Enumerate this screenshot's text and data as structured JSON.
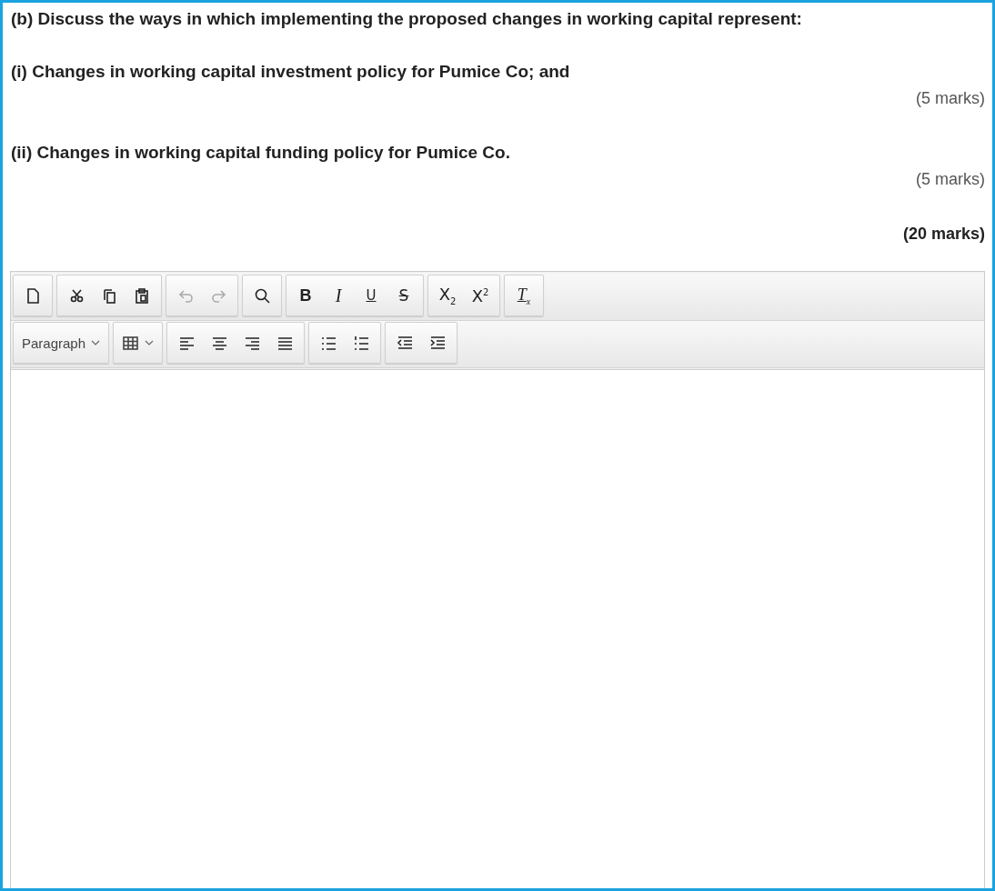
{
  "question": [
    {
      "kind": "text",
      "text": "(b) Discuss the ways in which implementing the proposed changes in working capital represent:"
    },
    {
      "kind": "text",
      "text": "(i) Changes in working capital investment policy for Pumice Co; and"
    },
    {
      "kind": "marks",
      "text": "(5 marks)"
    },
    {
      "kind": "text",
      "text": "(ii) Changes in working capital funding policy for Pumice Co."
    },
    {
      "kind": "marks",
      "text": "(5 marks)"
    },
    {
      "kind": "total",
      "text": "(20 marks)"
    }
  ],
  "editor": {
    "toolbar_rows": [
      [
        [
          {
            "kind": "icon",
            "disabled": false
          }
        ],
        [
          {
            "kind": "icon",
            "disabled": false
          },
          {
            "kind": "icon",
            "disabled": false
          },
          {
            "kind": "icon",
            "disabled": false
          }
        ],
        [
          {
            "kind": "icon",
            "disabled": true
          },
          {
            "kind": "icon",
            "disabled": true
          }
        ],
        [
          {
            "kind": "icon",
            "disabled": false
          }
        ],
        [
          {
            "kind": "text",
            "label": "B"
          },
          {
            "kind": "text",
            "label": "I"
          },
          {
            "kind": "text",
            "label": "U"
          },
          {
            "kind": "text",
            "label": "S"
          }
        ],
        [
          {
            "kind": "text",
            "label": "X$_{2}$"
          },
          {
            "kind": "text",
            "label": "X$^{2}$"
          }
        ],
        [
          {
            "kind": "text",
            "label": "T$_{x}$"
          }
        ]
      ],
      [
        [
          {
            "kind": "select",
            "label": "Paragraph"
          }
        ],
        [
          {
            "kind": "icon-select"
          }
        ],
        [
          {
            "kind": "icon",
            "disabled": false
          },
          {
            "kind": "icon",
            "disabled": false
          },
          {
            "kind": "icon",
            "disabled": false
          },
          {
            "kind": "icon",
            "disabled": false
          }
        ],
        [
          {
            "kind": "icon",
            "disabled": false
          },
          {
            "kind": "icon",
            "disabled": false
          }
        ],
        [
          {
            "kind": "icon",
            "disabled": false
          },
          {
            "kind": "icon",
            "disabled": false
          }
        ]
      ]
    ]
  }
}
